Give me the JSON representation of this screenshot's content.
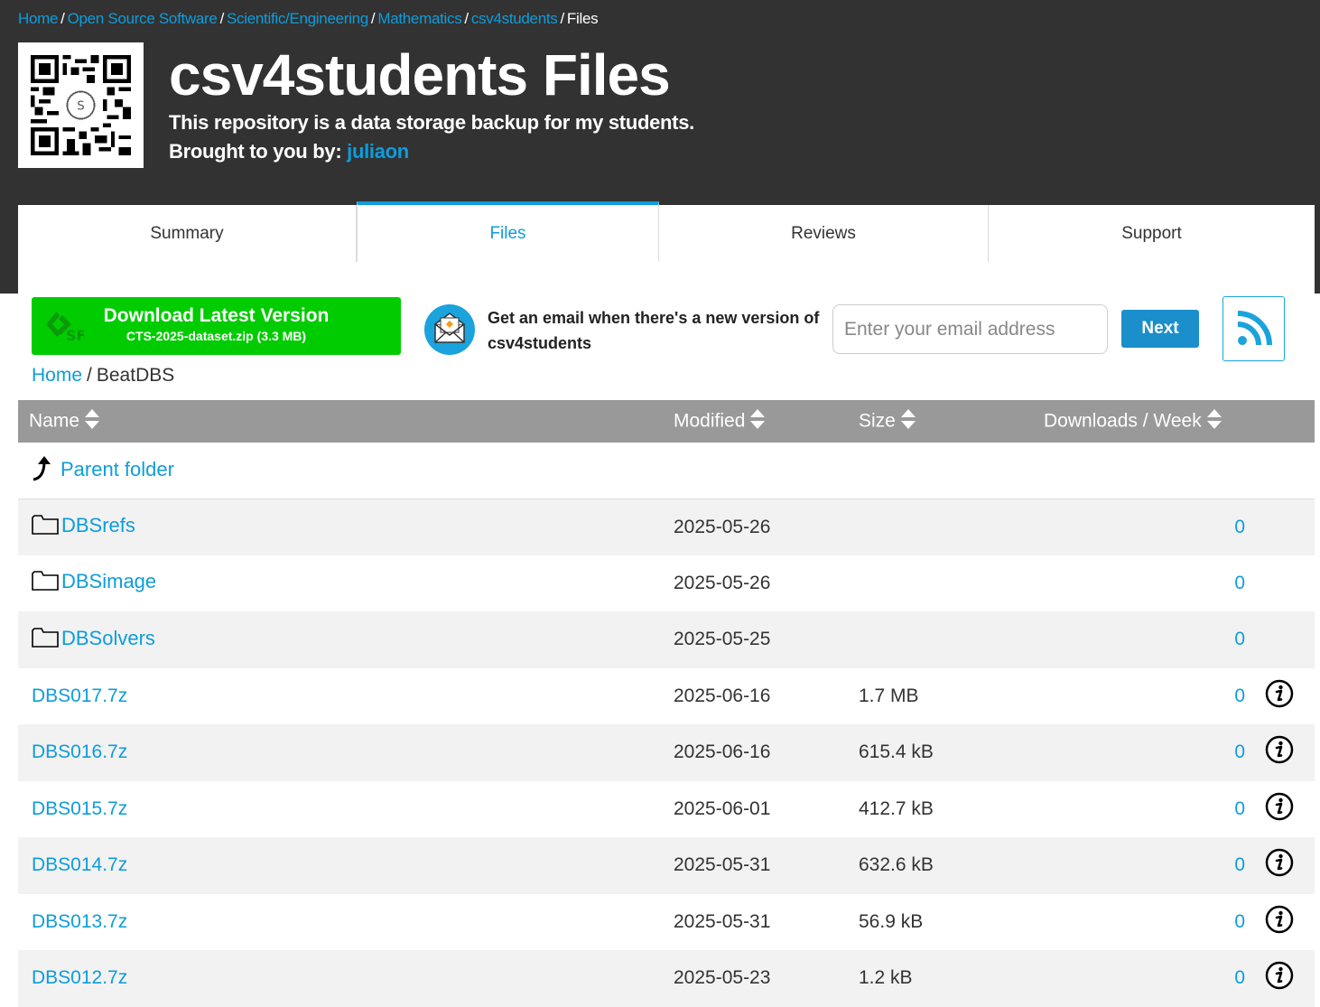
{
  "breadcrumb": {
    "items": [
      "Home",
      "Open Source Software",
      "Scientific/Engineering",
      "Mathematics",
      "csv4students"
    ],
    "current": "Files",
    "separator": "/"
  },
  "project": {
    "title": "csv4students Files",
    "description": "This repository is a data storage backup for my students.",
    "byline_label": "Brought to you by:",
    "author": "juliaon"
  },
  "tabs": [
    {
      "label": "Summary",
      "active": false
    },
    {
      "label": "Files",
      "active": true
    },
    {
      "label": "Reviews",
      "active": false
    },
    {
      "label": "Support",
      "active": false
    }
  ],
  "download": {
    "title": "Download Latest Version",
    "file": "CTS-2025-dataset.zip (3.3 MB)"
  },
  "notify": {
    "text": "Get an email when there's a new version of csv4students",
    "placeholder": "Enter your email address",
    "button": "Next"
  },
  "path": {
    "home": "Home",
    "separator": "/",
    "current": "BeatDBS"
  },
  "table": {
    "headers": {
      "name": "Name",
      "modified": "Modified",
      "size": "Size",
      "downloads": "Downloads / Week"
    },
    "parent": "Parent folder",
    "rows": [
      {
        "name": "DBSrefs",
        "type": "folder",
        "modified": "2025-05-26",
        "size": "",
        "downloads": "0"
      },
      {
        "name": "DBSimage",
        "type": "folder",
        "modified": "2025-05-26",
        "size": "",
        "downloads": "0"
      },
      {
        "name": "DBSolvers",
        "type": "folder",
        "modified": "2025-05-25",
        "size": "",
        "downloads": "0"
      },
      {
        "name": "DBS017.7z",
        "type": "file",
        "modified": "2025-06-16",
        "size": "1.7 MB",
        "downloads": "0"
      },
      {
        "name": "DBS016.7z",
        "type": "file",
        "modified": "2025-06-16",
        "size": "615.4 kB",
        "downloads": "0"
      },
      {
        "name": "DBS015.7z",
        "type": "file",
        "modified": "2025-06-01",
        "size": "412.7 kB",
        "downloads": "0"
      },
      {
        "name": "DBS014.7z",
        "type": "file",
        "modified": "2025-05-31",
        "size": "632.6 kB",
        "downloads": "0"
      },
      {
        "name": "DBS013.7z",
        "type": "file",
        "modified": "2025-05-31",
        "size": "56.9 kB",
        "downloads": "0"
      },
      {
        "name": "DBS012.7z",
        "type": "file",
        "modified": "2025-05-23",
        "size": "1.2 kB",
        "downloads": "0"
      }
    ]
  },
  "colors": {
    "header_bg": "#323232",
    "link": "#0d9ddb",
    "download_green": "#00cc00",
    "table_header": "#999999",
    "row_alt": "#f2f2f2"
  },
  "icons": {
    "qr": "qr-code-icon",
    "sf_logo": "sourceforge-logo-icon",
    "mail": "mail-icon",
    "rss": "rss-icon",
    "sort": "sort-icon",
    "folder": "folder-icon",
    "parent": "parent-folder-arrow-icon",
    "info": "info-icon"
  }
}
